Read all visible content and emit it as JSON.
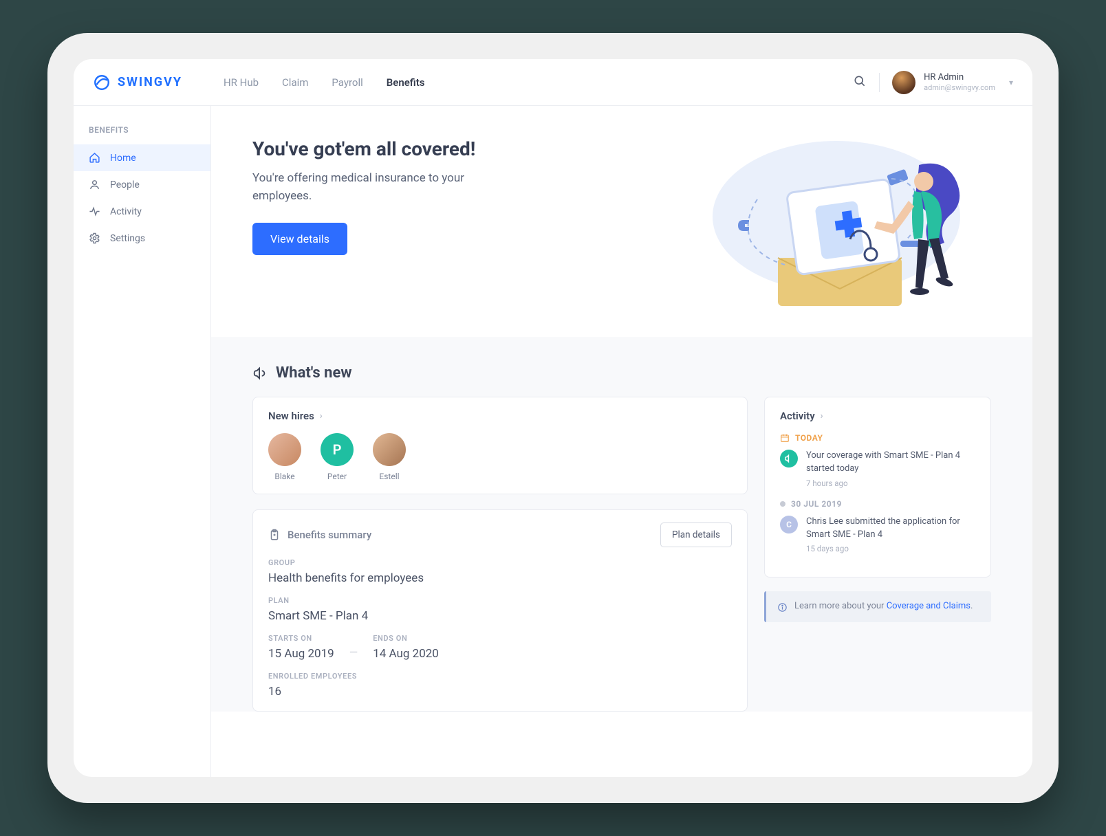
{
  "brand": "SWINGVY",
  "nav": {
    "items": [
      "HR Hub",
      "Claim",
      "Payroll",
      "Benefits"
    ],
    "active": "Benefits"
  },
  "user": {
    "name": "HR Admin",
    "email": "admin@swingvy.com"
  },
  "sidebar": {
    "title": "BENEFITS",
    "items": [
      {
        "label": "Home",
        "icon": "home",
        "active": true
      },
      {
        "label": "People",
        "icon": "user"
      },
      {
        "label": "Activity",
        "icon": "activity"
      },
      {
        "label": "Settings",
        "icon": "gear"
      }
    ]
  },
  "hero": {
    "title": "You've got'em all covered!",
    "subtitle": "You're offering medical insurance to your employees.",
    "cta": "View details"
  },
  "whats_new_title": "What's new",
  "new_hires": {
    "title": "New hires",
    "people": [
      {
        "name": "Blake"
      },
      {
        "name": "Peter",
        "initial": "P"
      },
      {
        "name": "Estell"
      }
    ]
  },
  "summary": {
    "title": "Benefits summary",
    "plan_details_btn": "Plan details",
    "fields": {
      "group_label": "GROUP",
      "group_val": "Health benefits for employees",
      "plan_label": "PLAN",
      "plan_val": "Smart SME - Plan 4",
      "starts_label": "STARTS ON",
      "starts_val": "15 Aug 2019",
      "ends_label": "ENDS ON",
      "ends_val": "14 Aug 2020",
      "enrolled_label": "ENROLLED EMPLOYEES",
      "enrolled_val": "16"
    }
  },
  "activity": {
    "title": "Activity",
    "today_label": "TODAY",
    "item1_text": "Your coverage with Smart SME - Plan 4 started today",
    "item1_time": "7 hours ago",
    "date2": "30 JUL 2019",
    "item2_text": "Chris Lee submitted the application for Smart SME - Plan 4",
    "item2_time": "15 days ago",
    "item2_initial": "C"
  },
  "info": {
    "prefix": "Learn more about your ",
    "link": "Coverage and Claims",
    "suffix": "."
  }
}
